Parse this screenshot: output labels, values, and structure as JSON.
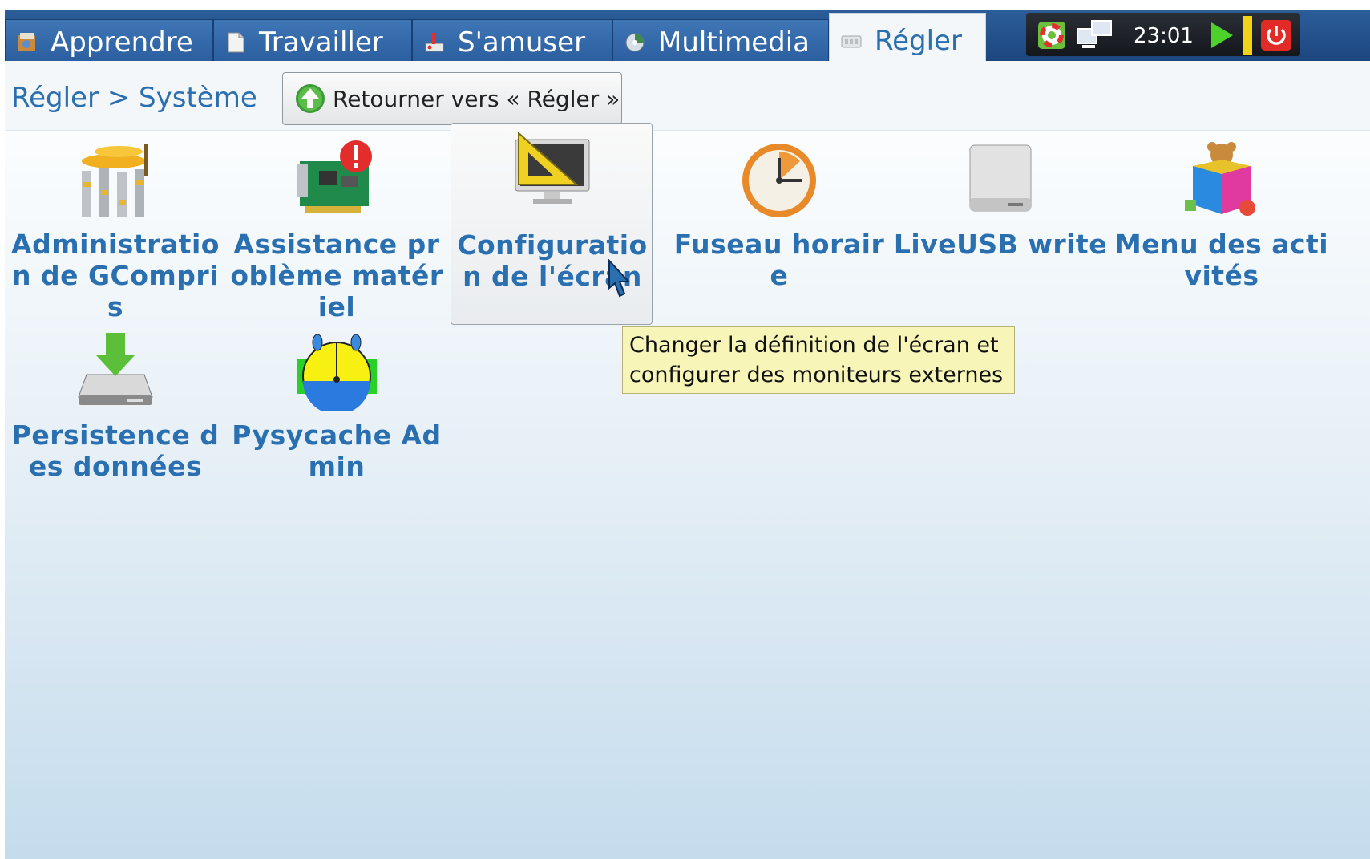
{
  "tabs": [
    {
      "label": "Apprendre",
      "icon": "apprendre-icon"
    },
    {
      "label": "Travailler",
      "icon": "travailler-icon"
    },
    {
      "label": "S'amuser",
      "icon": "samuser-icon"
    },
    {
      "label": "Multimedia",
      "icon": "multimedia-icon"
    },
    {
      "label": "Régler",
      "icon": "regler-icon",
      "active": true
    }
  ],
  "tray": {
    "clock": "23:01"
  },
  "breadcrumb": "Régler > Système",
  "back_button": {
    "label": "Retourner vers « Régler »"
  },
  "items": [
    {
      "label": "Administration de GCompris",
      "icon": "gcompris-admin-icon"
    },
    {
      "label": "Assistance problème matériel",
      "icon": "hardware-card-icon"
    },
    {
      "label": "Configuration de l'écran",
      "icon": "screen-config-icon",
      "hovered": true
    },
    {
      "label": "Fuseau horaire",
      "icon": "clock-icon"
    },
    {
      "label": "LiveUSB write",
      "icon": "usb-drive-icon"
    },
    {
      "label": "Menu des activités",
      "icon": "toy-box-icon"
    },
    {
      "label": "Persistence des données",
      "icon": "disk-download-icon"
    },
    {
      "label": "Pysycache Admin",
      "icon": "pysycache-icon"
    }
  ],
  "tooltip": "Changer la définition de l'écran et configurer des moniteurs externes",
  "colors": {
    "accent_text": "#2a6fb0",
    "tab_bg": "#2d5e9a",
    "tooltip_bg": "#f8f5b8"
  }
}
